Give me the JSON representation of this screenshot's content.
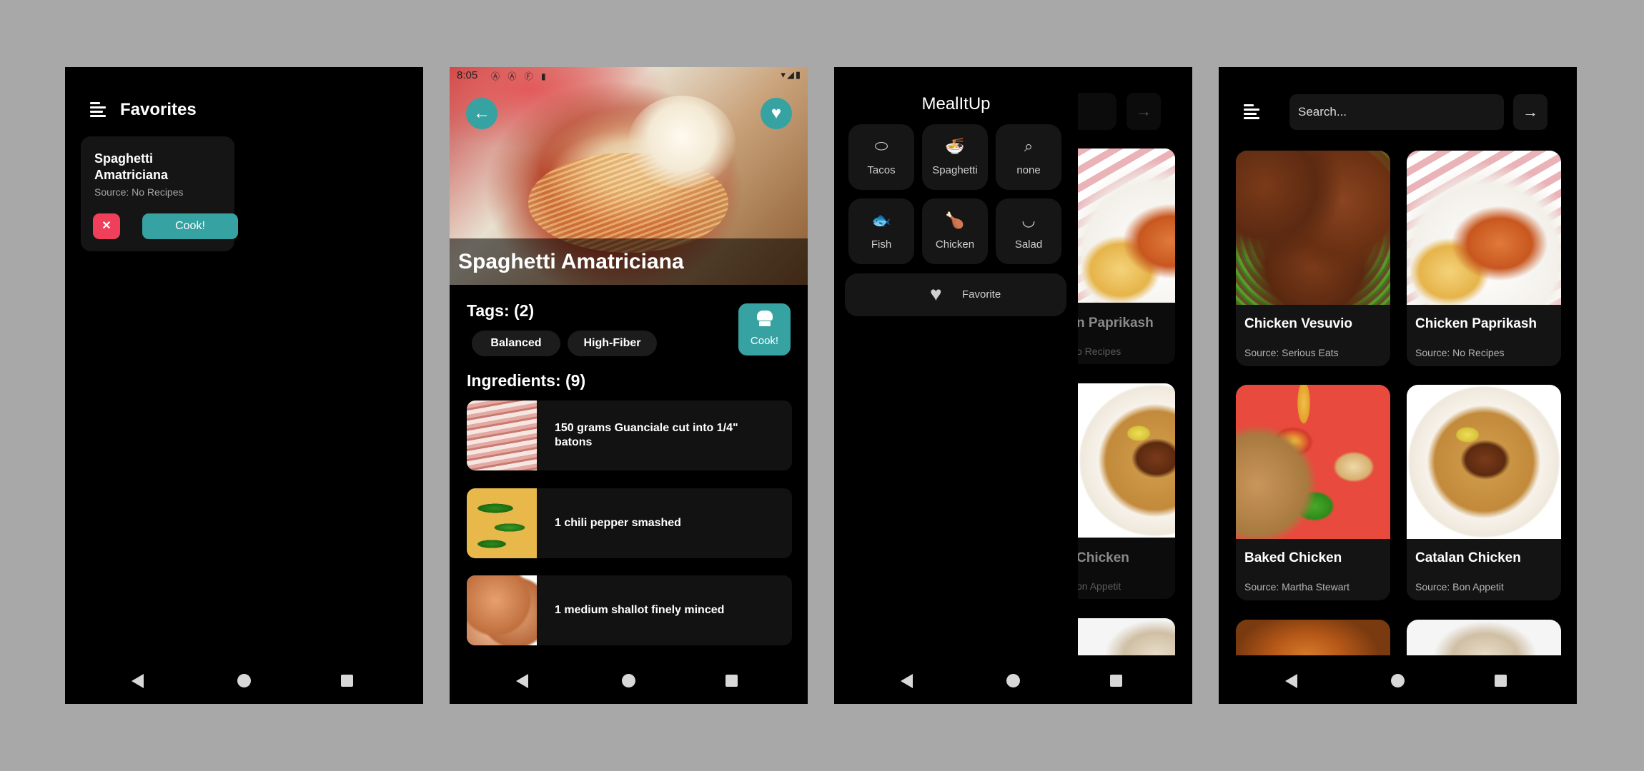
{
  "favorites_screen": {
    "title": "Favorites",
    "card": {
      "name": "Spaghetti Amatriciana",
      "source": "Source: No Recipes",
      "remove_label": "✕",
      "cook_label": "Cook!"
    }
  },
  "detail_screen": {
    "status_bar": {
      "time": "8:05",
      "icons": "Ⓐ Ⓐ Ⓕ ▮",
      "right": "▾◢▮"
    },
    "title": "Spaghetti Amatriciana",
    "back_icon": "←",
    "heart_icon": "♥",
    "tags_title": "Tags: (2)",
    "tags": [
      "Balanced",
      "High-Fiber"
    ],
    "cook_label": "Cook!",
    "ingredients_title": "Ingredients: (9)",
    "ingredients": [
      {
        "text": "150 grams Guanciale cut into 1/4\" batons",
        "icon": "bacon-photo"
      },
      {
        "text": "1 chili pepper smashed",
        "icon": "chili-photo"
      },
      {
        "text": "1 medium shallot finely minced",
        "icon": "shallot-photo"
      }
    ]
  },
  "drawer_screen": {
    "app_title": "MealItUp",
    "categories": [
      {
        "label": "Tacos",
        "icon": "⬭"
      },
      {
        "label": "Spaghetti",
        "icon": "🍜"
      },
      {
        "label": "none",
        "icon": "⌕"
      },
      {
        "label": "Fish",
        "icon": "🐟"
      },
      {
        "label": "Chicken",
        "icon": "🍗"
      },
      {
        "label": "Salad",
        "icon": "◡"
      }
    ],
    "favorite_label": "Favorite",
    "favorite_icon": "♥",
    "behind_cards": [
      {
        "name": "n Paprikash",
        "source": "o Recipes"
      },
      {
        "name": " Chicken",
        "source": "on Appetit"
      }
    ],
    "behind_arrow": "→"
  },
  "search_screen": {
    "search_placeholder": "Search...",
    "go_icon": "→",
    "recipes": [
      {
        "name": "Chicken Vesuvio",
        "source": "Source: Serious Eats"
      },
      {
        "name": "Chicken Paprikash",
        "source": "Source: No Recipes"
      },
      {
        "name": "Baked Chicken",
        "source": "Source: Martha Stewart"
      },
      {
        "name": "Catalan Chicken",
        "source": "Source: Bon Appetit"
      }
    ]
  },
  "colors": {
    "accent": "#36a2a2",
    "danger": "#ef3f5a",
    "background": "#000000",
    "card": "#151515",
    "outer": "#a8a8a8"
  }
}
